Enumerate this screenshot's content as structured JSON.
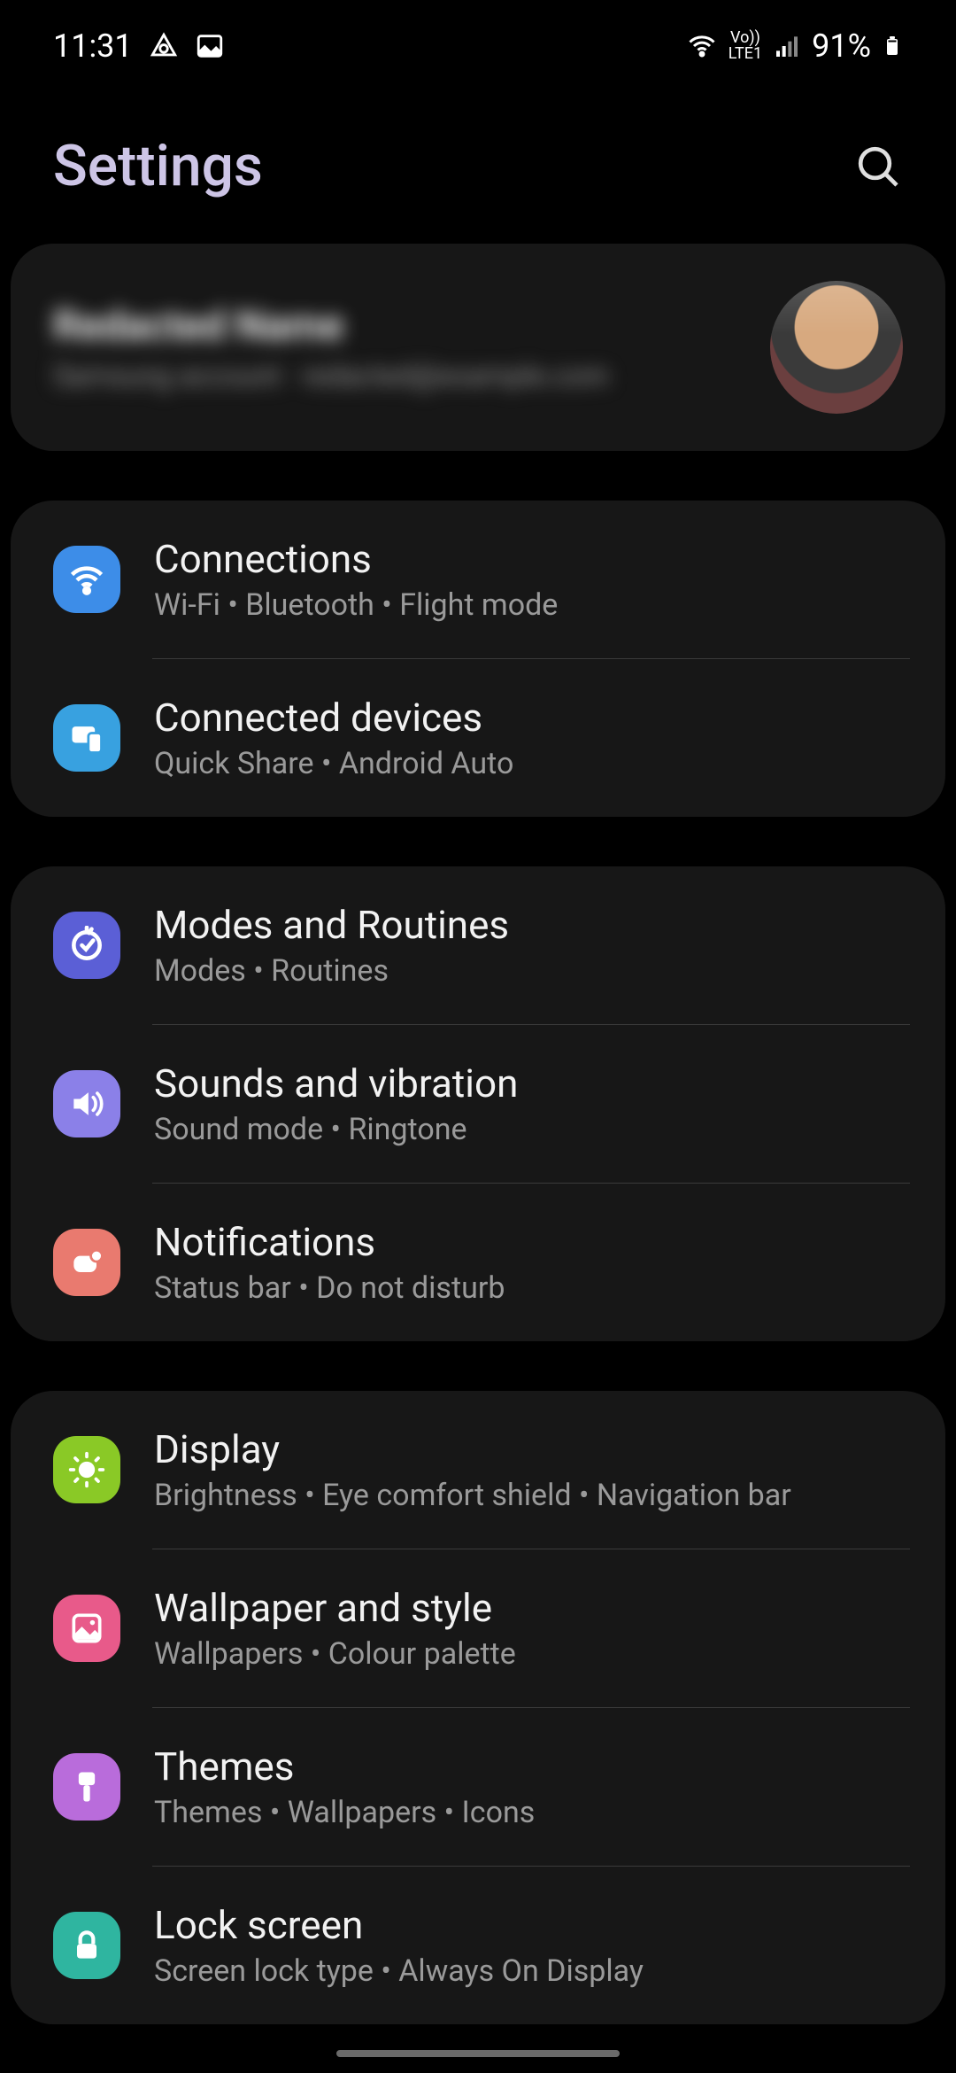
{
  "status": {
    "time": "11:31",
    "battery": "91%",
    "net_label_top": "Vo))",
    "net_label_bottom": "LTE1"
  },
  "header": {
    "title": "Settings"
  },
  "profile": {
    "name": "Redacted Name",
    "sub": "Samsung account · redacted@example.com"
  },
  "groups": [
    {
      "rows": [
        {
          "icon": "wifi-icon",
          "chip": "c-blue",
          "title": "Connections",
          "sub": "Wi-Fi  •  Bluetooth  •  Flight mode"
        },
        {
          "icon": "devices-icon",
          "chip": "c-blue2",
          "title": "Connected devices",
          "sub": "Quick Share  •  Android Auto"
        }
      ]
    },
    {
      "rows": [
        {
          "icon": "routines-icon",
          "chip": "c-indigo",
          "title": "Modes and Routines",
          "sub": "Modes  •  Routines"
        },
        {
          "icon": "sound-icon",
          "chip": "c-purple",
          "title": "Sounds and vibration",
          "sub": "Sound mode  •  Ringtone"
        },
        {
          "icon": "notifications-icon",
          "chip": "c-orange",
          "title": "Notifications",
          "sub": "Status bar  •  Do not disturb"
        }
      ]
    },
    {
      "rows": [
        {
          "icon": "display-icon",
          "chip": "c-green",
          "title": "Display",
          "sub": "Brightness  •  Eye comfort shield  •  Navigation bar"
        },
        {
          "icon": "wallpaper-icon",
          "chip": "c-pink",
          "title": "Wallpaper and style",
          "sub": "Wallpapers  •  Colour palette"
        },
        {
          "icon": "themes-icon",
          "chip": "c-magenta",
          "title": "Themes",
          "sub": "Themes  •  Wallpapers  •  Icons"
        },
        {
          "icon": "lock-icon",
          "chip": "c-teal",
          "title": "Lock screen",
          "sub": "Screen lock type  •  Always On Display"
        }
      ]
    }
  ]
}
